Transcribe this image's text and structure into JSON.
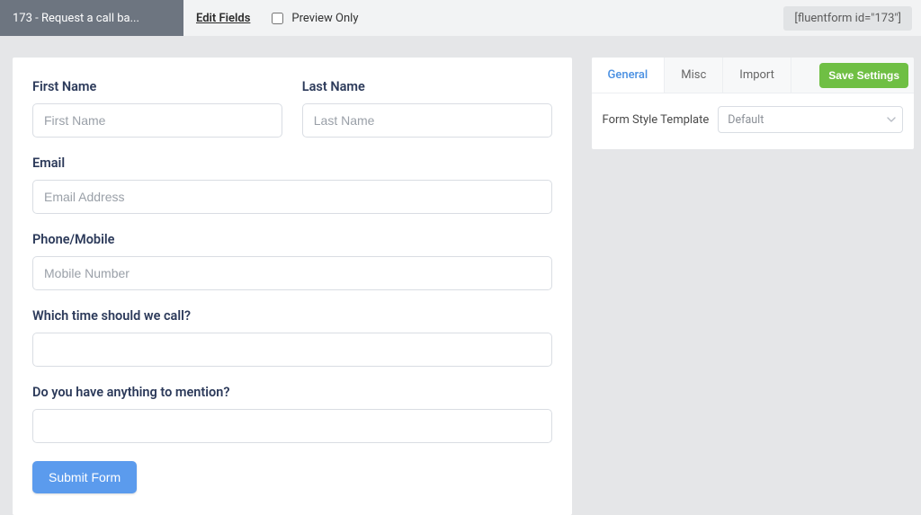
{
  "topbar": {
    "title": "173 - Request a call ba...",
    "edit_fields": "Edit Fields",
    "preview_only": "Preview Only",
    "shortcode": "[fluentform id=\"173\"]"
  },
  "form": {
    "first_name": {
      "label": "First Name",
      "placeholder": "First Name",
      "value": ""
    },
    "last_name": {
      "label": "Last Name",
      "placeholder": "Last Name",
      "value": ""
    },
    "email": {
      "label": "Email",
      "placeholder": "Email Address",
      "value": ""
    },
    "phone": {
      "label": "Phone/Mobile",
      "placeholder": "Mobile Number",
      "value": ""
    },
    "call_time": {
      "label": "Which time should we call?",
      "placeholder": "",
      "value": ""
    },
    "mention": {
      "label": "Do you have anything to mention?",
      "placeholder": "",
      "value": ""
    },
    "submit": "Submit Form"
  },
  "side": {
    "tabs": {
      "general": "General",
      "misc": "Misc",
      "import": "Import"
    },
    "save": "Save Settings",
    "form_style_label": "Form Style Template",
    "form_style_value": "Default"
  }
}
